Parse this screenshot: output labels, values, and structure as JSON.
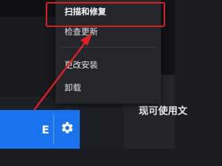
{
  "menu": {
    "items": [
      {
        "label": "扫描和修复"
      },
      {
        "label": "检查更新"
      },
      {
        "label": "更改安装"
      },
      {
        "label": "卸载"
      }
    ]
  },
  "banner": {
    "text": "现可使用文"
  },
  "action_bar": {
    "partial_label": "E"
  },
  "colors": {
    "menu_bg": "#24262b",
    "accent_blue": "#1c73f0",
    "annotation_red": "#e02020"
  },
  "icons": {
    "settings": "gear-icon"
  }
}
